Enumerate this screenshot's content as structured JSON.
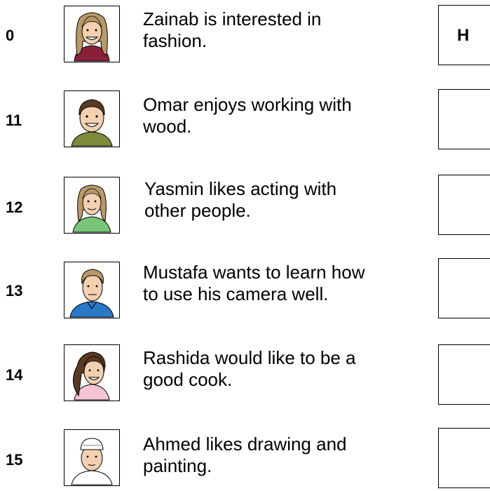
{
  "items": [
    {
      "number": "0",
      "text": "Zainab is interested in\nfashion.",
      "answer": "H",
      "portrait_icon": "girl-long-hair-smiling-icon"
    },
    {
      "number": "11",
      "text": "Omar enjoys working with\nwood.",
      "answer": "",
      "portrait_icon": "boy-short-hair-smiling-icon"
    },
    {
      "number": "12",
      "text": "Yasmin likes acting with\nother people.",
      "answer": "",
      "portrait_icon": "woman-green-top-icon"
    },
    {
      "number": "13",
      "text": "Mustafa wants to learn how\nto use his camera well.",
      "answer": "",
      "portrait_icon": "boy-blue-shirt-icon"
    },
    {
      "number": "14",
      "text": "Rashida would like to be a\ngood cook.",
      "answer": "",
      "portrait_icon": "girl-ponytail-pink-top-icon"
    },
    {
      "number": "15",
      "text": "Ahmed likes drawing and\npainting.",
      "answer": "",
      "portrait_icon": "boy-white-cap-icon"
    }
  ],
  "colors": {
    "skin": "#f2d0b0",
    "hair_light": "#b89a6a",
    "hair_dark": "#5a3a22",
    "shirt_maroon": "#8a2038",
    "shirt_olive": "#7f8a3c",
    "shirt_green": "#78c478",
    "shirt_blue": "#2a78c8",
    "shirt_pink": "#f4c4d4",
    "cap_white": "#ffffff"
  }
}
